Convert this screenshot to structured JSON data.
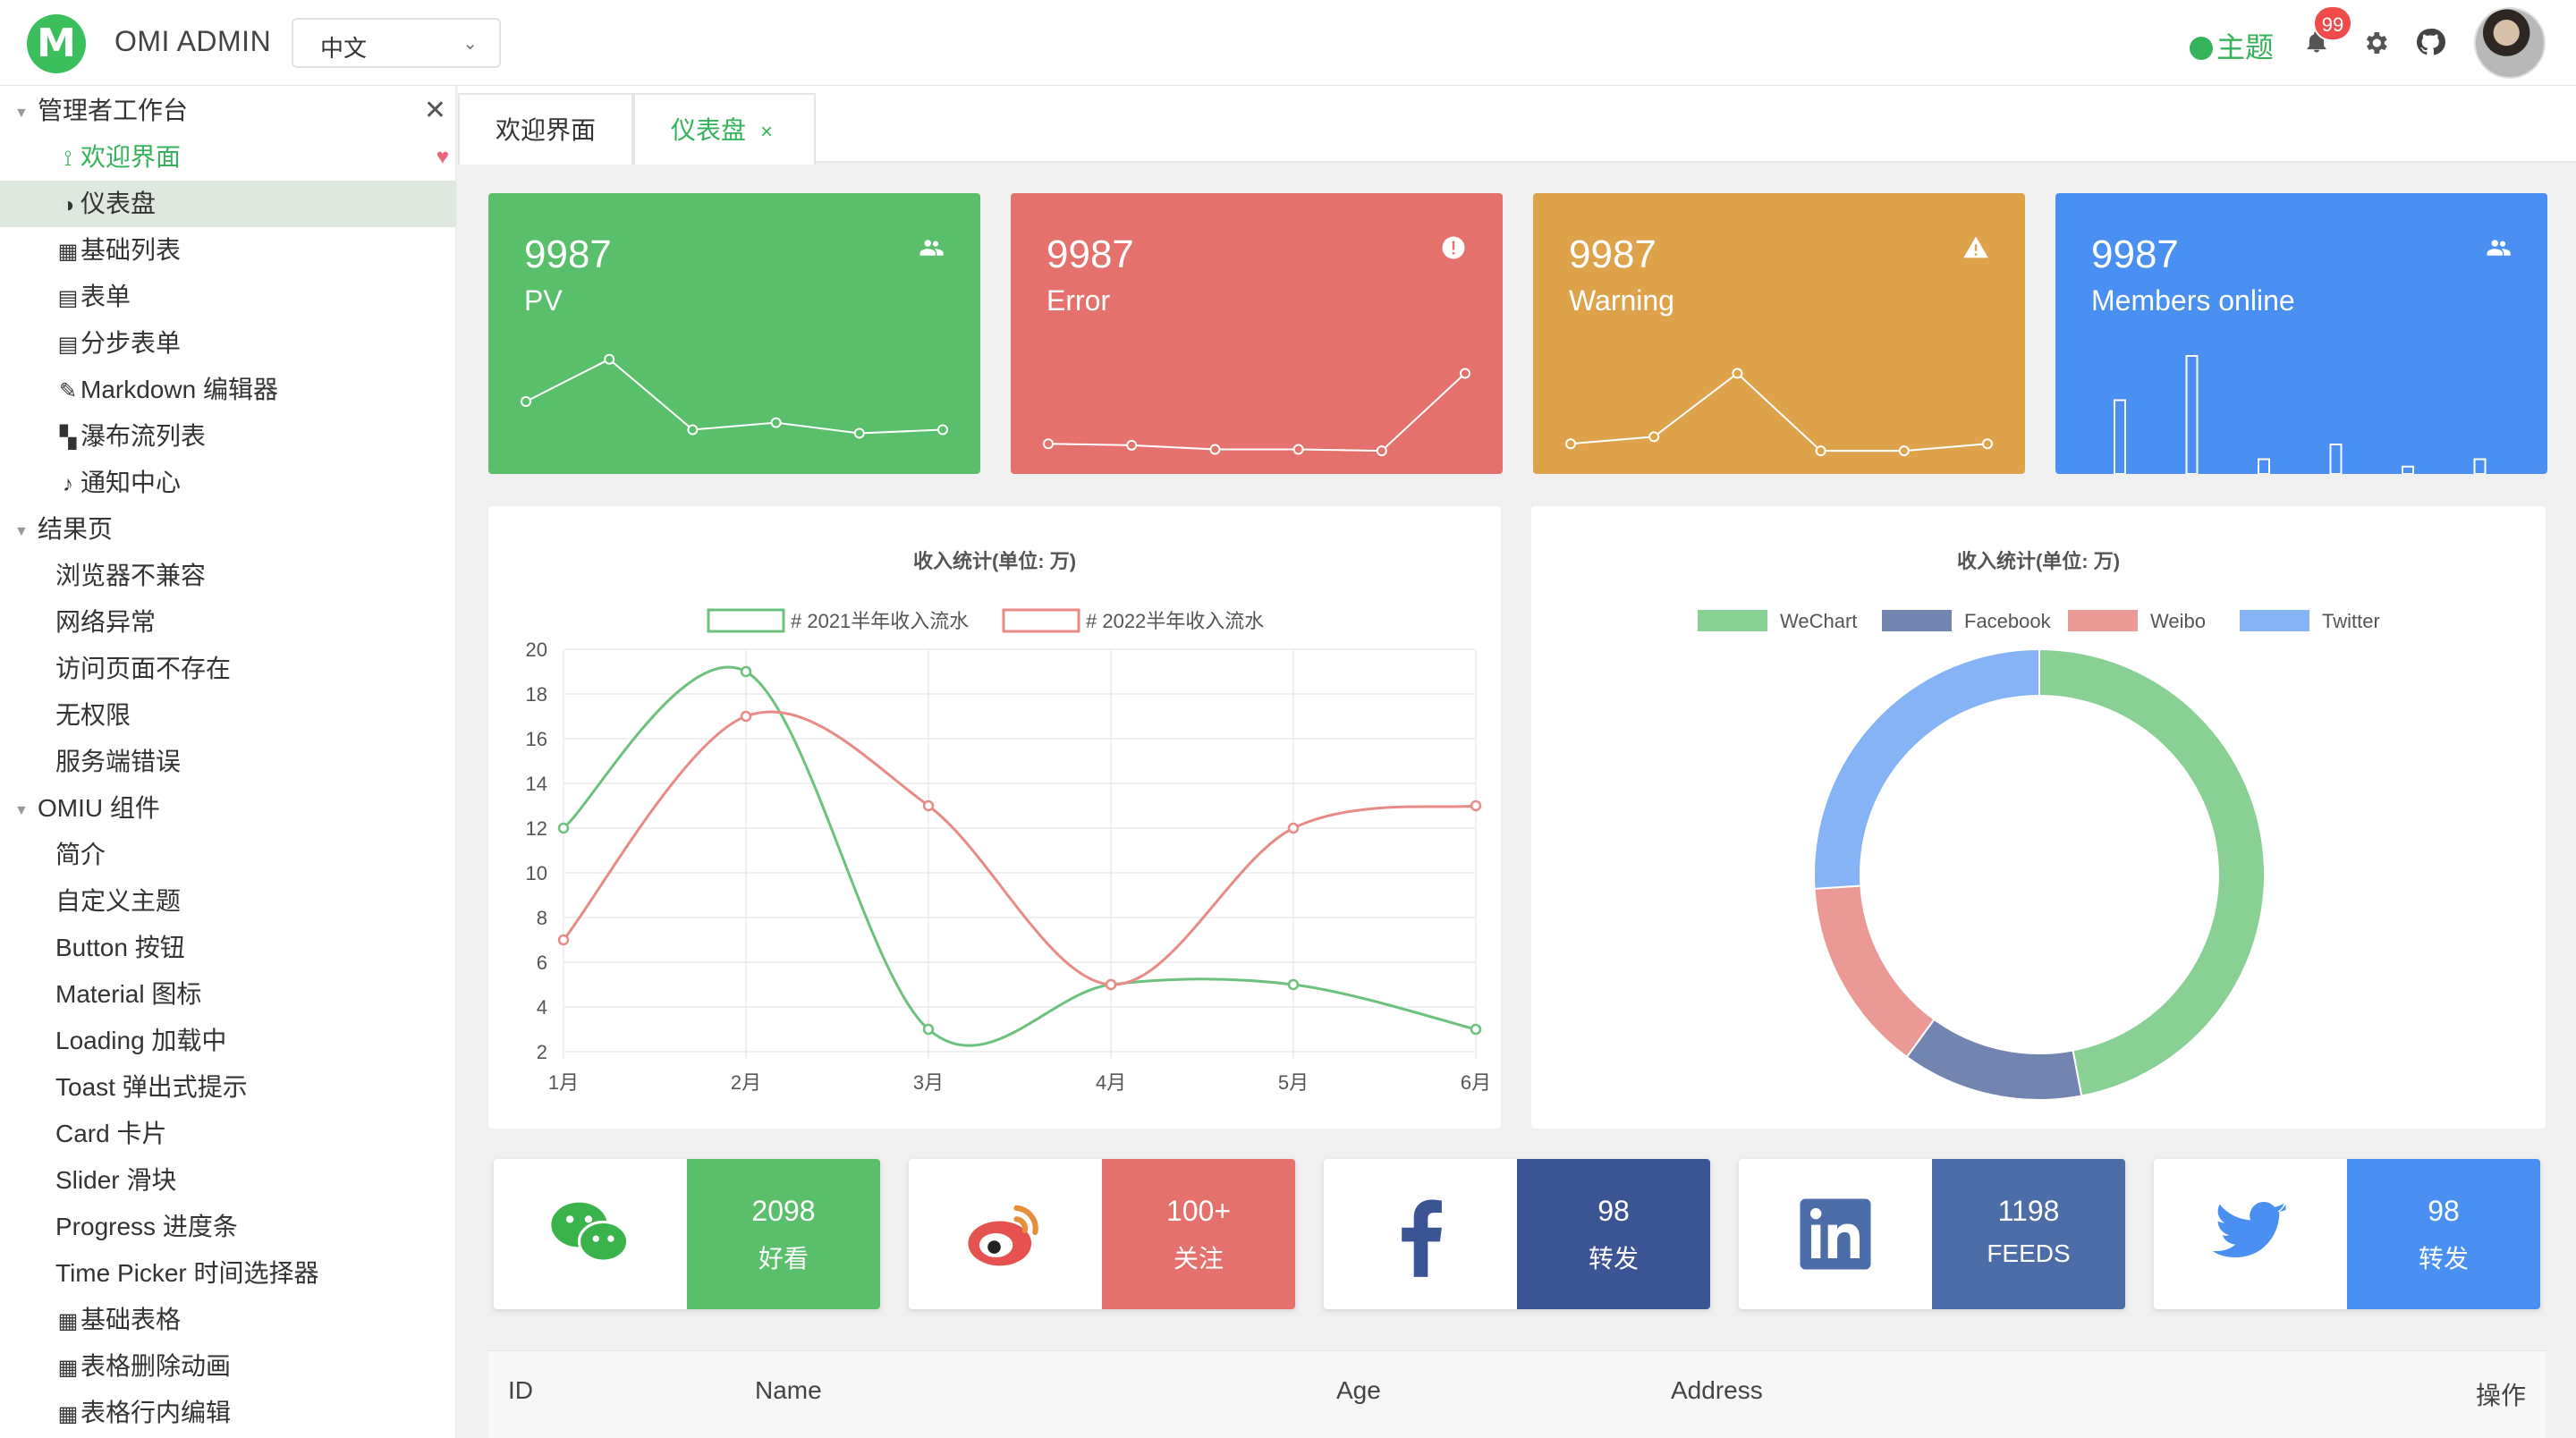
{
  "header": {
    "logo_letter": "M",
    "app_title": "OMI ADMIN",
    "language": "中文",
    "theme_label": "主题",
    "notification_count": "99"
  },
  "sidebar": {
    "rows": [
      {
        "type": "group",
        "label": "管理者工作台"
      },
      {
        "type": "item",
        "icon": "⟟",
        "label": "欢迎界面",
        "state": "green"
      },
      {
        "type": "item",
        "icon": "◑",
        "label": "仪表盘",
        "state": "selected"
      },
      {
        "type": "item",
        "icon": "▦",
        "label": "基础列表"
      },
      {
        "type": "item",
        "icon": "▤",
        "label": "表单"
      },
      {
        "type": "item",
        "icon": "▤",
        "label": "分步表单"
      },
      {
        "type": "item",
        "icon": "✎",
        "label": "Markdown 编辑器"
      },
      {
        "type": "item",
        "icon": "▚",
        "label": "瀑布流列表"
      },
      {
        "type": "item",
        "icon": "♪",
        "label": "通知中心"
      },
      {
        "type": "group",
        "label": "结果页"
      },
      {
        "type": "item",
        "icon": "",
        "label": "浏览器不兼容"
      },
      {
        "type": "item",
        "icon": "",
        "label": "网络异常"
      },
      {
        "type": "item",
        "icon": "",
        "label": "访问页面不存在"
      },
      {
        "type": "item",
        "icon": "",
        "label": "无权限"
      },
      {
        "type": "item",
        "icon": "",
        "label": "服务端错误"
      },
      {
        "type": "group",
        "label": "OMIU 组件"
      },
      {
        "type": "item",
        "icon": "",
        "label": "简介"
      },
      {
        "type": "item",
        "icon": "",
        "label": "自定义主题"
      },
      {
        "type": "item",
        "icon": "",
        "label": "Button 按钮"
      },
      {
        "type": "item",
        "icon": "",
        "label": "Material 图标"
      },
      {
        "type": "item",
        "icon": "",
        "label": "Loading 加载中"
      },
      {
        "type": "item",
        "icon": "",
        "label": "Toast 弹出式提示"
      },
      {
        "type": "item",
        "icon": "",
        "label": "Card 卡片"
      },
      {
        "type": "item",
        "icon": "",
        "label": "Slider 滑块"
      },
      {
        "type": "item",
        "icon": "",
        "label": "Progress 进度条"
      },
      {
        "type": "item",
        "icon": "",
        "label": "Time Picker 时间选择器"
      },
      {
        "type": "item",
        "icon": "▦",
        "label": "基础表格"
      },
      {
        "type": "item",
        "icon": "▦",
        "label": "表格删除动画"
      },
      {
        "type": "item",
        "icon": "▦",
        "label": "表格行内编辑"
      }
    ]
  },
  "tabs": [
    {
      "label": "欢迎界面"
    },
    {
      "label": "仪表盘",
      "close": "×"
    }
  ],
  "stats": [
    {
      "value": "9987",
      "label": "PV",
      "color": "#59bf6b",
      "icon": "people-icon",
      "spark": [
        8,
        14,
        4,
        5,
        3.5,
        4
      ]
    },
    {
      "value": "9987",
      "label": "Error",
      "color": "#e5716d",
      "icon": "alert-circle-icon",
      "spark": [
        2,
        1.8,
        1.2,
        1.2,
        1,
        12
      ]
    },
    {
      "value": "9987",
      "label": "Warning",
      "color": "#dea34a",
      "icon": "warning-icon",
      "spark": [
        2,
        3,
        12,
        1,
        1,
        2
      ]
    },
    {
      "value": "9987",
      "label": "Members online",
      "color": "#4a90f2",
      "icon": "people-icon",
      "bars": [
        10,
        16,
        2,
        4,
        1,
        2
      ]
    }
  ],
  "line_panel_title": "收入统计(单位: 万)",
  "donut_panel_title": "收入统计(单位: 万)",
  "chart_data": [
    {
      "type": "line",
      "title": "收入统计(单位: 万)",
      "categories": [
        "1月",
        "2月",
        "3月",
        "4月",
        "5月",
        "6月"
      ],
      "series": [
        {
          "name": "# 2021半年收入流水",
          "color": "#6cc17d",
          "values": [
            12,
            19,
            3,
            5,
            5,
            3
          ]
        },
        {
          "name": "# 2022半年收入流水",
          "color": "#e88a86",
          "values": [
            7,
            17,
            13,
            5,
            12,
            13
          ]
        }
      ],
      "ylim": [
        2,
        20
      ],
      "yticks": [
        2,
        4,
        6,
        8,
        10,
        12,
        14,
        16,
        18,
        20
      ],
      "grid": true,
      "legend": "top"
    },
    {
      "type": "pie",
      "title": "收入统计(单位: 万)",
      "categories": [
        "WeChart",
        "Facebook",
        "Weibo",
        "Twitter"
      ],
      "values": [
        47,
        13,
        14,
        26
      ],
      "colors": [
        "#88d093",
        "#7285b0",
        "#ea9995",
        "#85b3f5"
      ],
      "legend": "top"
    }
  ],
  "social": [
    {
      "icon": "wechat-icon",
      "value": "2098",
      "label": "好看",
      "color": "#59bf6b"
    },
    {
      "icon": "weibo-icon",
      "value": "100+",
      "label": "关注",
      "color": "#e5716d"
    },
    {
      "icon": "facebook-icon",
      "value": "98",
      "label": "转发",
      "color": "#3b5493"
    },
    {
      "icon": "linkedin-icon",
      "value": "1198",
      "label": "FEEDS",
      "color": "#4c6da8"
    },
    {
      "icon": "twitter-icon",
      "value": "98",
      "label": "转发",
      "color": "#4a90f2"
    }
  ],
  "table": {
    "headers": [
      "ID",
      "Name",
      "Age",
      "Address",
      "操作"
    ]
  }
}
